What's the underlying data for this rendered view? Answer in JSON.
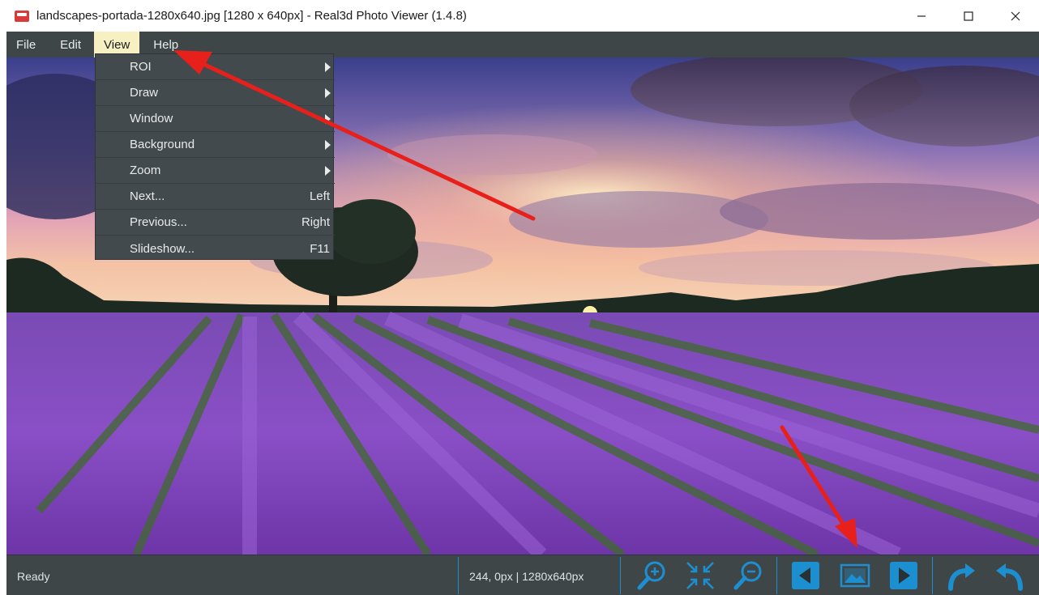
{
  "window": {
    "title": "landscapes-portada-1280x640.jpg [1280 x 640px] - Real3d Photo Viewer (1.4.8)"
  },
  "menubar": {
    "items": [
      {
        "label": "File"
      },
      {
        "label": "Edit"
      },
      {
        "label": "View",
        "active": true
      },
      {
        "label": "Help"
      }
    ]
  },
  "view_menu": {
    "items": [
      {
        "label": "ROI",
        "submenu": true
      },
      {
        "label": "Draw",
        "submenu": true
      },
      {
        "label": "Window",
        "submenu": true
      },
      {
        "label": "Background",
        "submenu": true
      },
      {
        "label": "Zoom",
        "submenu": true
      },
      {
        "label": "Next...",
        "shortcut": "Left"
      },
      {
        "label": "Previous...",
        "shortcut": "Right"
      },
      {
        "label": "Slideshow...",
        "shortcut": "F11"
      }
    ]
  },
  "statusbar": {
    "status": "Ready",
    "coords": "244, 0px | 1280x640px"
  },
  "toolbar": {
    "icons": [
      "zoom-in-icon",
      "fit-to-window-icon",
      "zoom-out-icon",
      "previous-image-icon",
      "image-icon",
      "next-image-icon",
      "redo-icon",
      "undo-icon"
    ]
  },
  "colors": {
    "menubar_bg": "#3f4648",
    "menu_active_bg": "#f6f0c2",
    "accent_blue": "#1c8fd0",
    "annotation_red": "#e8201c"
  }
}
